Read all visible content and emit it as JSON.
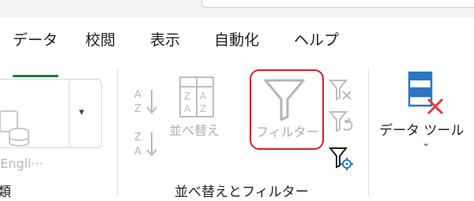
{
  "tabs": [
    {
      "label": "データ",
      "active": true
    },
    {
      "label": "校閲",
      "active": false
    },
    {
      "label": "表示",
      "active": false
    },
    {
      "label": "自動化",
      "active": false
    },
    {
      "label": "ヘルプ",
      "active": false
    }
  ],
  "ribbon": {
    "left_group": {
      "english_label": "(Engli···",
      "group_label": "類"
    },
    "sort_filter_group": {
      "sort_label": "並べ替え",
      "filter_label": "フィルター",
      "group_label": "並べ替えとフィルター"
    },
    "data_tools": {
      "label": "データ ツール"
    }
  },
  "colors": {
    "accent_green": "#127a3e",
    "highlight_red": "#d0202f",
    "disabled_gray": "#b0b0b0",
    "blue": "#2b78c2",
    "red_x": "#e23b3b"
  },
  "icons": [
    "coin-stack-icon",
    "dropdown-chevron-icon",
    "sort-a-z-icon",
    "sort-z-a-icon",
    "sort-icon",
    "funnel-icon",
    "clear-filter-icon",
    "reapply-filter-icon",
    "advanced-filter-icon",
    "data-tools-icon",
    "chevron-down-icon"
  ]
}
